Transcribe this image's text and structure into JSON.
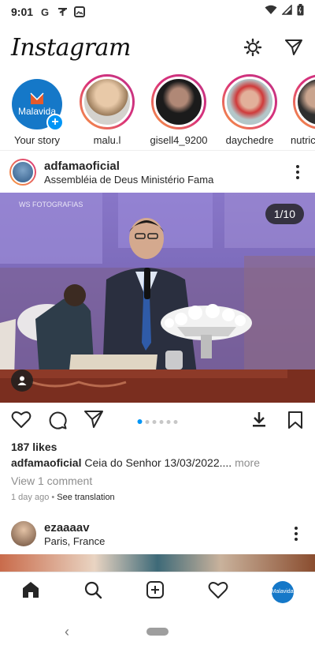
{
  "status": {
    "time": "9:01",
    "icons": [
      "google-g-icon",
      "signal-t-icon",
      "photo-icon",
      "wifi-icon",
      "cell-signal-icon",
      "battery-icon"
    ]
  },
  "app": {
    "title": "Instagram"
  },
  "stories": [
    {
      "name": "Your story",
      "avatar_text": "Malavida"
    },
    {
      "name": "malu.l"
    },
    {
      "name": "gisell4_9200"
    },
    {
      "name": "daychedre"
    },
    {
      "name": "nutricra"
    }
  ],
  "post": {
    "username": "adfamaoficial",
    "location": "Assembléia de Deus Ministério Fama",
    "counter": "1/10",
    "watermark": "WS FOTOGRAFIAS",
    "likes": "187 likes",
    "caption_user": "adfamaoficial",
    "caption_text": "Ceia do Senhor  13/03/2022....",
    "caption_more": "more",
    "view_comments": "View 1 comment",
    "time_ago": "1 day ago",
    "meta_sep": " • ",
    "see_translation": "See translation",
    "carousel_total": 6,
    "carousel_active": 0
  },
  "post2": {
    "username": "ezaaaav",
    "location": "Paris, France"
  },
  "bottom_nav": {
    "profile_avatar_text": "Malavida"
  },
  "colors": {
    "accent": "#0095f6",
    "story_ring": "#d9317a"
  }
}
